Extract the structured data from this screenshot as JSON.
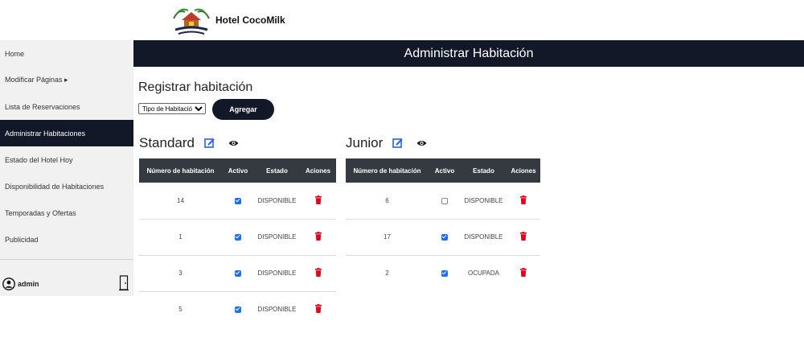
{
  "brand": {
    "name": "Hotel CocoMilk"
  },
  "sidebar": {
    "items": [
      {
        "label": "Home"
      },
      {
        "label": "Modificar Páginas ▸"
      },
      {
        "label": "Lista de Reservaciones"
      },
      {
        "label": "Administrar Habitaciones"
      },
      {
        "label": "Estado del Hotel Hoy"
      },
      {
        "label": "Disponibilidad de Habitaciones"
      },
      {
        "label": "Temporadas y Ofertas"
      },
      {
        "label": "Publicidad"
      }
    ],
    "active_index": 3,
    "user": "admin"
  },
  "header": {
    "title": "Administrar Habitación"
  },
  "register": {
    "title": "Registrar habitación",
    "select_value": "Tipo de Habitación",
    "add_label": "Agregar"
  },
  "columns": [
    "Número de habitación",
    "Activo",
    "Estado",
    "Aciones"
  ],
  "sections": [
    {
      "title": "Standard",
      "rows": [
        {
          "number": "14",
          "active": true,
          "status": "DISPONIBLE"
        },
        {
          "number": "1",
          "active": true,
          "status": "DISPONIBLE"
        },
        {
          "number": "3",
          "active": true,
          "status": "DISPONIBLE"
        },
        {
          "number": "5",
          "active": true,
          "status": "DISPONIBLE"
        }
      ]
    },
    {
      "title": "Junior",
      "rows": [
        {
          "number": "6",
          "active": false,
          "status": "DISPONIBLE"
        },
        {
          "number": "17",
          "active": true,
          "status": "DISPONIBLE"
        },
        {
          "number": "2",
          "active": true,
          "status": "OCUPADA"
        }
      ]
    }
  ],
  "colors": {
    "dark": "#121828",
    "table_header": "#343a40",
    "check": "#1a6ff5",
    "delete": "#e3001b",
    "edit": "#2563eb"
  }
}
